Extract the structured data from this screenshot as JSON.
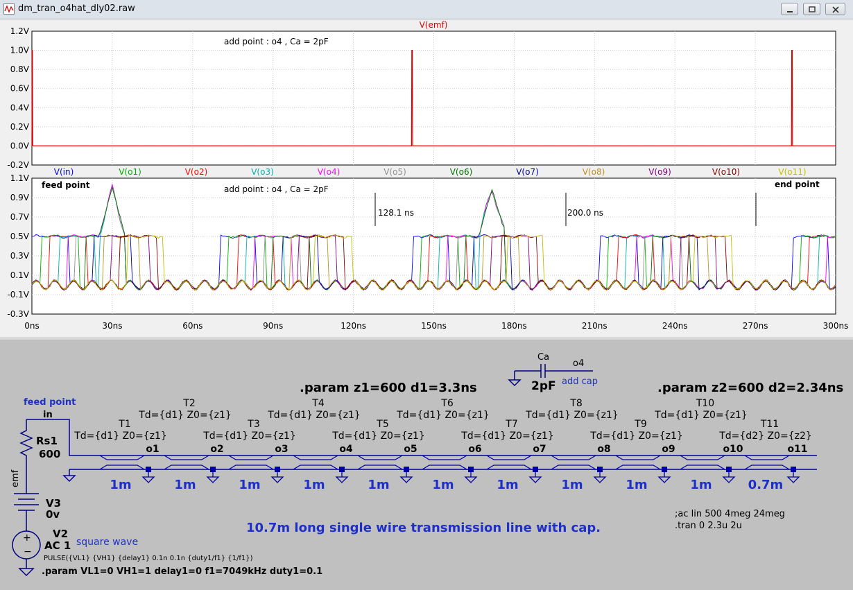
{
  "window": {
    "title": "dm_tran_o4hat_dly02.raw",
    "buttons": [
      "minimize",
      "restore",
      "close"
    ]
  },
  "colors": {
    "plot_bg": "#ffffff",
    "grid": "#c8c8c8",
    "schematic_bg": "#c0c0c0",
    "wire": "#0000a0",
    "label_blue": "#1f30c8"
  },
  "panes": {
    "top": {
      "trace_name": "V(emf)",
      "annotation": "add point : o4 , Ca = 2pF",
      "y_ticks": [
        "1.2V",
        "1.0V",
        "0.8V",
        "0.6V",
        "0.4V",
        "0.2V",
        "0.0V",
        "-0.2V"
      ]
    },
    "bottom": {
      "legend": [
        {
          "name": "V(in)",
          "color": "#0000ff"
        },
        {
          "name": "V(o1)",
          "color": "#00b000"
        },
        {
          "name": "V(o2)",
          "color": "#ff0000"
        },
        {
          "name": "V(o3)",
          "color": "#00b0b0"
        },
        {
          "name": "V(o4)",
          "color": "#ff00ff"
        },
        {
          "name": "V(o5)",
          "color": "#909090"
        },
        {
          "name": "V(o6)",
          "color": "#007000"
        },
        {
          "name": "V(o7)",
          "color": "#0000a0"
        },
        {
          "name": "V(o8)",
          "color": "#c09020"
        },
        {
          "name": "V(o9)",
          "color": "#800080"
        },
        {
          "name": "V(o10)",
          "color": "#800000"
        },
        {
          "name": "V(o11)",
          "color": "#c0c000"
        }
      ],
      "annotation": "add point : o4 , Ca = 2pF",
      "feed_label": "feed point",
      "end_label": "end point",
      "cursor1": "128.1 ns",
      "cursor2": "200.0 ns",
      "y_ticks": [
        "1.1V",
        "0.9V",
        "0.7V",
        "0.5V",
        "0.3V",
        "0.1V",
        "-0.1V",
        "-0.3V"
      ],
      "x_ticks": [
        "0ns",
        "30ns",
        "60ns",
        "90ns",
        "120ns",
        "150ns",
        "180ns",
        "210ns",
        "240ns",
        "270ns",
        "300ns"
      ]
    }
  },
  "chart_data": [
    {
      "type": "line",
      "title": "V(emf)",
      "xlabel": "",
      "ylabel": "",
      "xlim": [
        0,
        300
      ],
      "ylim": [
        -0.2,
        1.2
      ],
      "grid": true,
      "series": [
        {
          "name": "V(emf)",
          "x": [
            0,
            0.1,
            0.2,
            0.3,
            141.7,
            141.8,
            142.0,
            142.1,
            283.5,
            283.6,
            283.8,
            283.9,
            300
          ],
          "y": [
            0,
            1,
            1,
            0,
            0,
            1,
            1,
            0,
            0,
            1,
            1,
            0,
            0
          ]
        }
      ]
    },
    {
      "type": "line",
      "title": "",
      "xlabel": "",
      "ylabel": "",
      "xlim": [
        0,
        300
      ],
      "ylim": [
        -0.3,
        1.1
      ],
      "grid": true,
      "series_names": [
        "V(in)",
        "V(o1)",
        "V(o2)",
        "V(o3)",
        "V(o4)",
        "V(o5)",
        "V(o6)",
        "V(o7)",
        "V(o8)",
        "V(o9)",
        "V(o10)",
        "V(o11)"
      ],
      "pulse_high": 0.5,
      "peak_at_o4": 1.0,
      "edge_delays_ns": [
        0,
        3.3,
        6.6,
        9.9,
        13.2,
        16.5,
        19.8,
        23.1,
        26.4,
        29.7,
        33.0,
        35.34
      ]
    }
  ],
  "schematic": {
    "feed_point": "feed point",
    "in_label": "in",
    "rs1": {
      "name": "Rs1",
      "value": "600"
    },
    "emf_label": "emf",
    "v3": {
      "name": "V3",
      "value": "0v"
    },
    "v2": {
      "name": "V2",
      "value": "AC 1"
    },
    "square_wave": "square wave",
    "pulse": "PULSE({VL1} {VH1} {delay1} 0.1n 0.1n {duty1/f1} {1/f1})",
    "param_source": ".param VL1=0 VH1=1 delay1=0 f1=7049kHz duty1=0.1",
    "param1": ".param z1=600 d1=3.3ns",
    "param2": ".param z2=600 d2=2.34ns",
    "cap": {
      "name": "Ca",
      "value": "2pF",
      "node": "o4",
      "note": "add cap"
    },
    "lines": [
      {
        "name": "T1",
        "td": "Td={d1} Z0={z1}",
        "node": "o1",
        "len": "1m"
      },
      {
        "name": "T2",
        "td": "Td={d1} Z0={z1}",
        "node": "o2",
        "len": "1m"
      },
      {
        "name": "T3",
        "td": "Td={d1} Z0={z1}",
        "node": "o3",
        "len": "1m"
      },
      {
        "name": "T4",
        "td": "Td={d1} Z0={z1}",
        "node": "o4",
        "len": "1m"
      },
      {
        "name": "T5",
        "td": "Td={d1} Z0={z1}",
        "node": "o5",
        "len": "1m"
      },
      {
        "name": "T6",
        "td": "Td={d1} Z0={z1}",
        "node": "o6",
        "len": "1m"
      },
      {
        "name": "T7",
        "td": "Td={d1} Z0={z1}",
        "node": "o7",
        "len": "1m"
      },
      {
        "name": "T8",
        "td": "Td={d1} Z0={z1}",
        "node": "o8",
        "len": "1m"
      },
      {
        "name": "T9",
        "td": "Td={d1} Z0={z1}",
        "node": "o9",
        "len": "1m"
      },
      {
        "name": "T10",
        "td": "Td={d1} Z0={z1}",
        "node": "o10",
        "len": "1m"
      },
      {
        "name": "T11",
        "td": "Td={d2} Z0={z2}",
        "node": "o11",
        "len": "0.7m"
      }
    ],
    "caption": "10.7m long single wire transmission line with cap.",
    "ac_cmd": ";ac lin 500 4meg 24meg",
    "tran_cmd": ".tran 0 2.3u 2u"
  }
}
